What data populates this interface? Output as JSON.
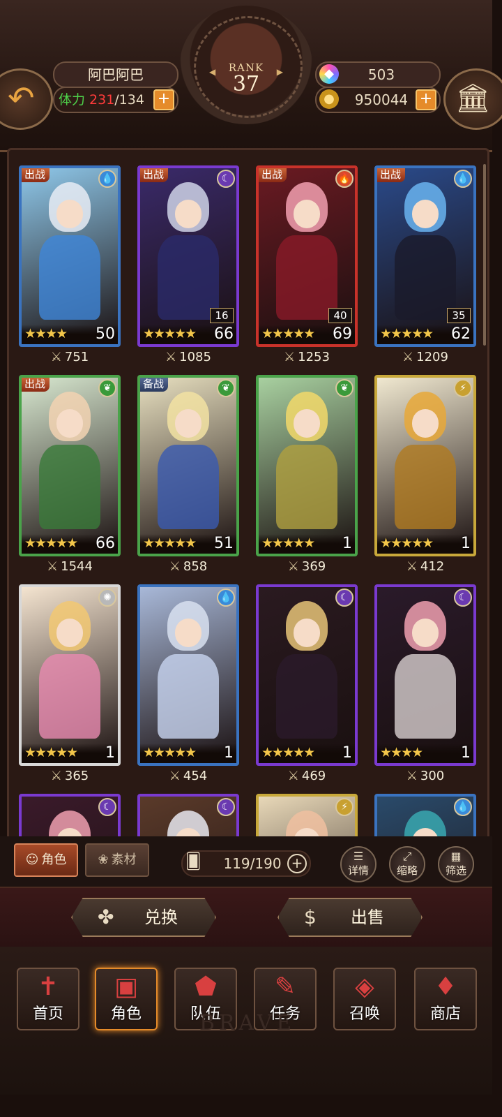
{
  "header": {
    "player_name": "阿巴阿巴",
    "stamina_label": "体力",
    "stamina_current": "231",
    "stamina_max": "/134",
    "rank_label": "RANK",
    "rank_value": "37",
    "gems": "503",
    "gold": "950044",
    "plus": "+"
  },
  "cards": [
    {
      "tag": "出战",
      "element": "water",
      "stars": "★★★★",
      "level": "50",
      "sub": "",
      "power": "751",
      "frame": "#3a73c0",
      "hair": "#e8ecf4",
      "body": "#3f86d8",
      "bg": "#8fc8ea"
    },
    {
      "tag": "出战",
      "element": "dark",
      "stars": "★★★★★",
      "level": "66",
      "sub": "16",
      "power": "1085",
      "frame": "#7a3ad0",
      "hair": "#cfd4e8",
      "body": "#2a2a6a",
      "bg": "#3a2a6a"
    },
    {
      "tag": "出战",
      "element": "fire",
      "stars": "★★★★★",
      "level": "69",
      "sub": "40",
      "power": "1253",
      "frame": "#c8322a",
      "hair": "#f2a0b0",
      "body": "#8a1a28",
      "bg": "#6a1a22"
    },
    {
      "tag": "出战",
      "element": "water",
      "stars": "★★★★★",
      "level": "62",
      "sub": "35",
      "power": "1209",
      "frame": "#3a73c0",
      "hair": "#6ab4f0",
      "body": "#1a1a2a",
      "bg": "#2a4a8a"
    },
    {
      "tag": "出战",
      "element": "wood",
      "stars": "★★★★★",
      "level": "66",
      "sub": "",
      "power": "1544",
      "frame": "#4aa34a",
      "hair": "#f2d2b2",
      "body": "#3a7a3a",
      "bg": "#d8e8d0"
    },
    {
      "tag": "备战",
      "element": "wood",
      "stars": "★★★★★",
      "level": "51",
      "sub": "",
      "power": "858",
      "frame": "#4aa34a",
      "hair": "#f2e2a2",
      "body": "#3a5ab0",
      "bg": "#e8e0c0"
    },
    {
      "tag": "",
      "element": "wood",
      "stars": "★★★★★",
      "level": "1",
      "sub": "",
      "power": "369",
      "frame": "#4aa34a",
      "hair": "#f2d86a",
      "body": "#b0a040",
      "bg": "#a8d0a0"
    },
    {
      "tag": "",
      "element": "light",
      "stars": "★★★★★",
      "level": "1",
      "sub": "",
      "power": "412",
      "frame": "#c8a83a",
      "hair": "#e8a838",
      "body": "#b07a20",
      "bg": "#f0e8d0"
    },
    {
      "tag": "",
      "element": "light2",
      "stars": "★★★★★",
      "level": "1",
      "sub": "",
      "power": "365",
      "frame": "#d8d8d8",
      "hair": "#f2c872",
      "body": "#e88ab0",
      "bg": "#f4e4d0"
    },
    {
      "tag": "",
      "element": "water",
      "stars": "★★★★★",
      "level": "1",
      "sub": "",
      "power": "454",
      "frame": "#3a73c0",
      "hair": "#d8e0f0",
      "body": "#c8d4f0",
      "bg": "#a8b8d8"
    },
    {
      "tag": "",
      "element": "dark",
      "stars": "★★★★★",
      "level": "1",
      "sub": "",
      "power": "469",
      "frame": "#7a3ad0",
      "hair": "#e8c478",
      "body": "#2a1a2a",
      "bg": "#2a1a20"
    },
    {
      "tag": "",
      "element": "dark",
      "stars": "★★★★",
      "level": "1",
      "sub": "",
      "power": "300",
      "frame": "#7a3ad0",
      "hair": "#f0a0b0",
      "body": "#d8d0d0",
      "bg": "#2a1a2a"
    },
    {
      "tag": "",
      "element": "dark",
      "stars": "",
      "level": "",
      "sub": "",
      "power": "",
      "frame": "#7a3ad0",
      "hair": "#f0a0b0",
      "body": "#2a1a2a",
      "bg": "#3a1a2a"
    },
    {
      "tag": "",
      "element": "dark",
      "stars": "",
      "level": "",
      "sub": "",
      "power": "",
      "frame": "#7a3ad0",
      "hair": "#e8e8f0",
      "body": "#2a1a2a",
      "bg": "#5a3a2a"
    },
    {
      "tag": "",
      "element": "light",
      "stars": "",
      "level": "",
      "sub": "",
      "power": "",
      "frame": "#c8a83a",
      "hair": "#f0c0a0",
      "body": "#a88a5a",
      "bg": "#e8d8b8"
    },
    {
      "tag": "",
      "element": "water",
      "stars": "",
      "level": "",
      "sub": "",
      "power": "",
      "frame": "#3a73c0",
      "hair": "#3aa8b0",
      "body": "#2a5a8a",
      "bg": "#2a4a6a"
    }
  ],
  "toolbar": {
    "role_tab": "角色",
    "material_tab": "素材",
    "capacity": "119/190",
    "details": "详情",
    "compact": "缩略",
    "filter": "筛选"
  },
  "actions": {
    "exchange": "兑换",
    "sell": "出售"
  },
  "nav": {
    "home": "首页",
    "role": "角色",
    "team": "队伍",
    "quest": "任务",
    "summon": "召唤",
    "shop": "商店"
  },
  "brand_text": "BRAVE"
}
